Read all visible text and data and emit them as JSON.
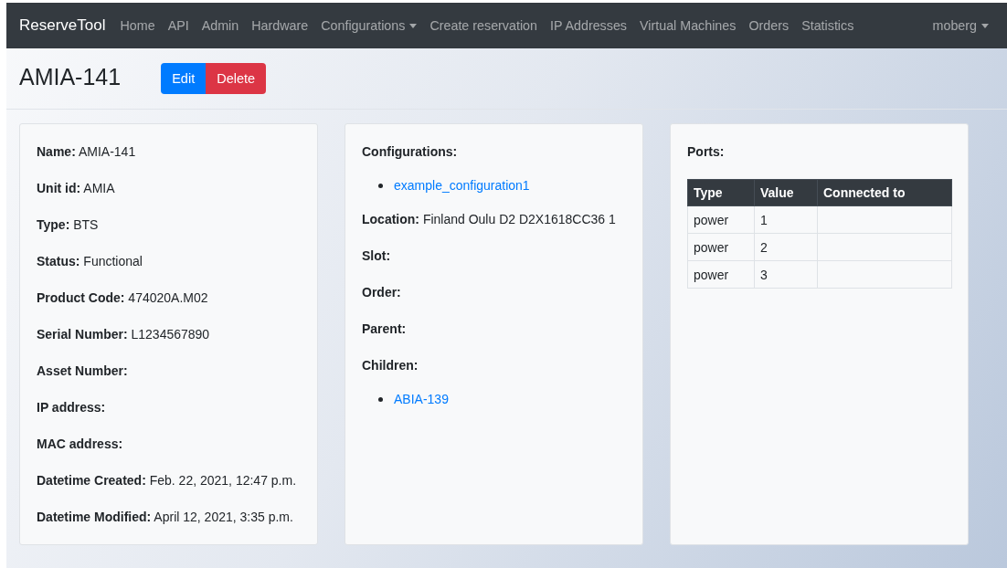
{
  "navbar": {
    "brand": "ReserveTool",
    "items": [
      {
        "label": "Home",
        "dropdown": false
      },
      {
        "label": "API",
        "dropdown": false
      },
      {
        "label": "Admin",
        "dropdown": false
      },
      {
        "label": "Hardware",
        "dropdown": false
      },
      {
        "label": "Configurations",
        "dropdown": true
      },
      {
        "label": "Create reservation",
        "dropdown": false
      },
      {
        "label": "IP Addresses",
        "dropdown": false
      },
      {
        "label": "Virtual Machines",
        "dropdown": false
      },
      {
        "label": "Orders",
        "dropdown": false
      },
      {
        "label": "Statistics",
        "dropdown": false
      }
    ],
    "user": {
      "label": "moberg",
      "dropdown": true
    }
  },
  "header": {
    "title": "AMIA-141",
    "buttons": [
      {
        "label": "Edit",
        "kind": "primary"
      },
      {
        "label": "Delete",
        "kind": "danger"
      }
    ]
  },
  "cards": [
    {
      "kind": "fields",
      "fields": [
        {
          "label": "Name:",
          "value": "AMIA-141"
        },
        {
          "label": "Unit id:",
          "value": "AMIA"
        },
        {
          "label": "Type:",
          "value": "BTS"
        },
        {
          "label": "Status:",
          "value": "Functional"
        },
        {
          "label": "Product Code:",
          "value": "474020A.M02"
        },
        {
          "label": "Serial Number:",
          "value": "L1234567890"
        },
        {
          "label": "Asset Number:"
        },
        {
          "label": "IP address:"
        },
        {
          "label": "MAC address:"
        },
        {
          "label": "Datetime Created:",
          "value": "Feb. 22, 2021, 12:47 p.m."
        },
        {
          "label": "Datetime Modified:",
          "value": "April 12, 2021, 3:35 p.m."
        }
      ]
    },
    {
      "kind": "fields",
      "fields": [
        {
          "label": "Configurations:",
          "links": [
            "example_configuration1"
          ]
        },
        {
          "label": "Location:",
          "value": "Finland Oulu D2 D2X1618CC36 1"
        },
        {
          "label": "Slot:"
        },
        {
          "label": "Order:"
        },
        {
          "label": "Parent:"
        },
        {
          "label": "Children:",
          "links": [
            "ABIA-139"
          ]
        }
      ]
    },
    {
      "kind": "table",
      "title": "Ports:",
      "columns": [
        "Type",
        "Value",
        "Connected to"
      ],
      "rows": [
        [
          "power",
          "1",
          ""
        ],
        [
          "power",
          "2",
          ""
        ],
        [
          "power",
          "3",
          ""
        ]
      ]
    }
  ]
}
